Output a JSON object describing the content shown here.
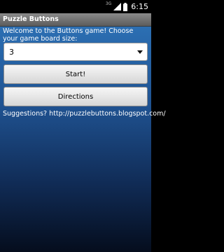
{
  "status_bar": {
    "network": "3G",
    "time": "6:15"
  },
  "app_title": "Puzzle Buttons",
  "welcome_text": "Welcome to the Buttons game! Choose your game board size:",
  "board_size": {
    "selected": "3"
  },
  "buttons": {
    "start": "Start!",
    "directions": "Directions"
  },
  "suggestions_text": "Suggestions? http://puzzlebuttons.blogspot.com/",
  "colors": {
    "background_top": "#2c6fb3",
    "background_bottom": "#050d1d",
    "title_bar": "#6e6e6e"
  },
  "icons": [
    "network-3g-icon",
    "signal-icon",
    "battery-icon"
  ]
}
